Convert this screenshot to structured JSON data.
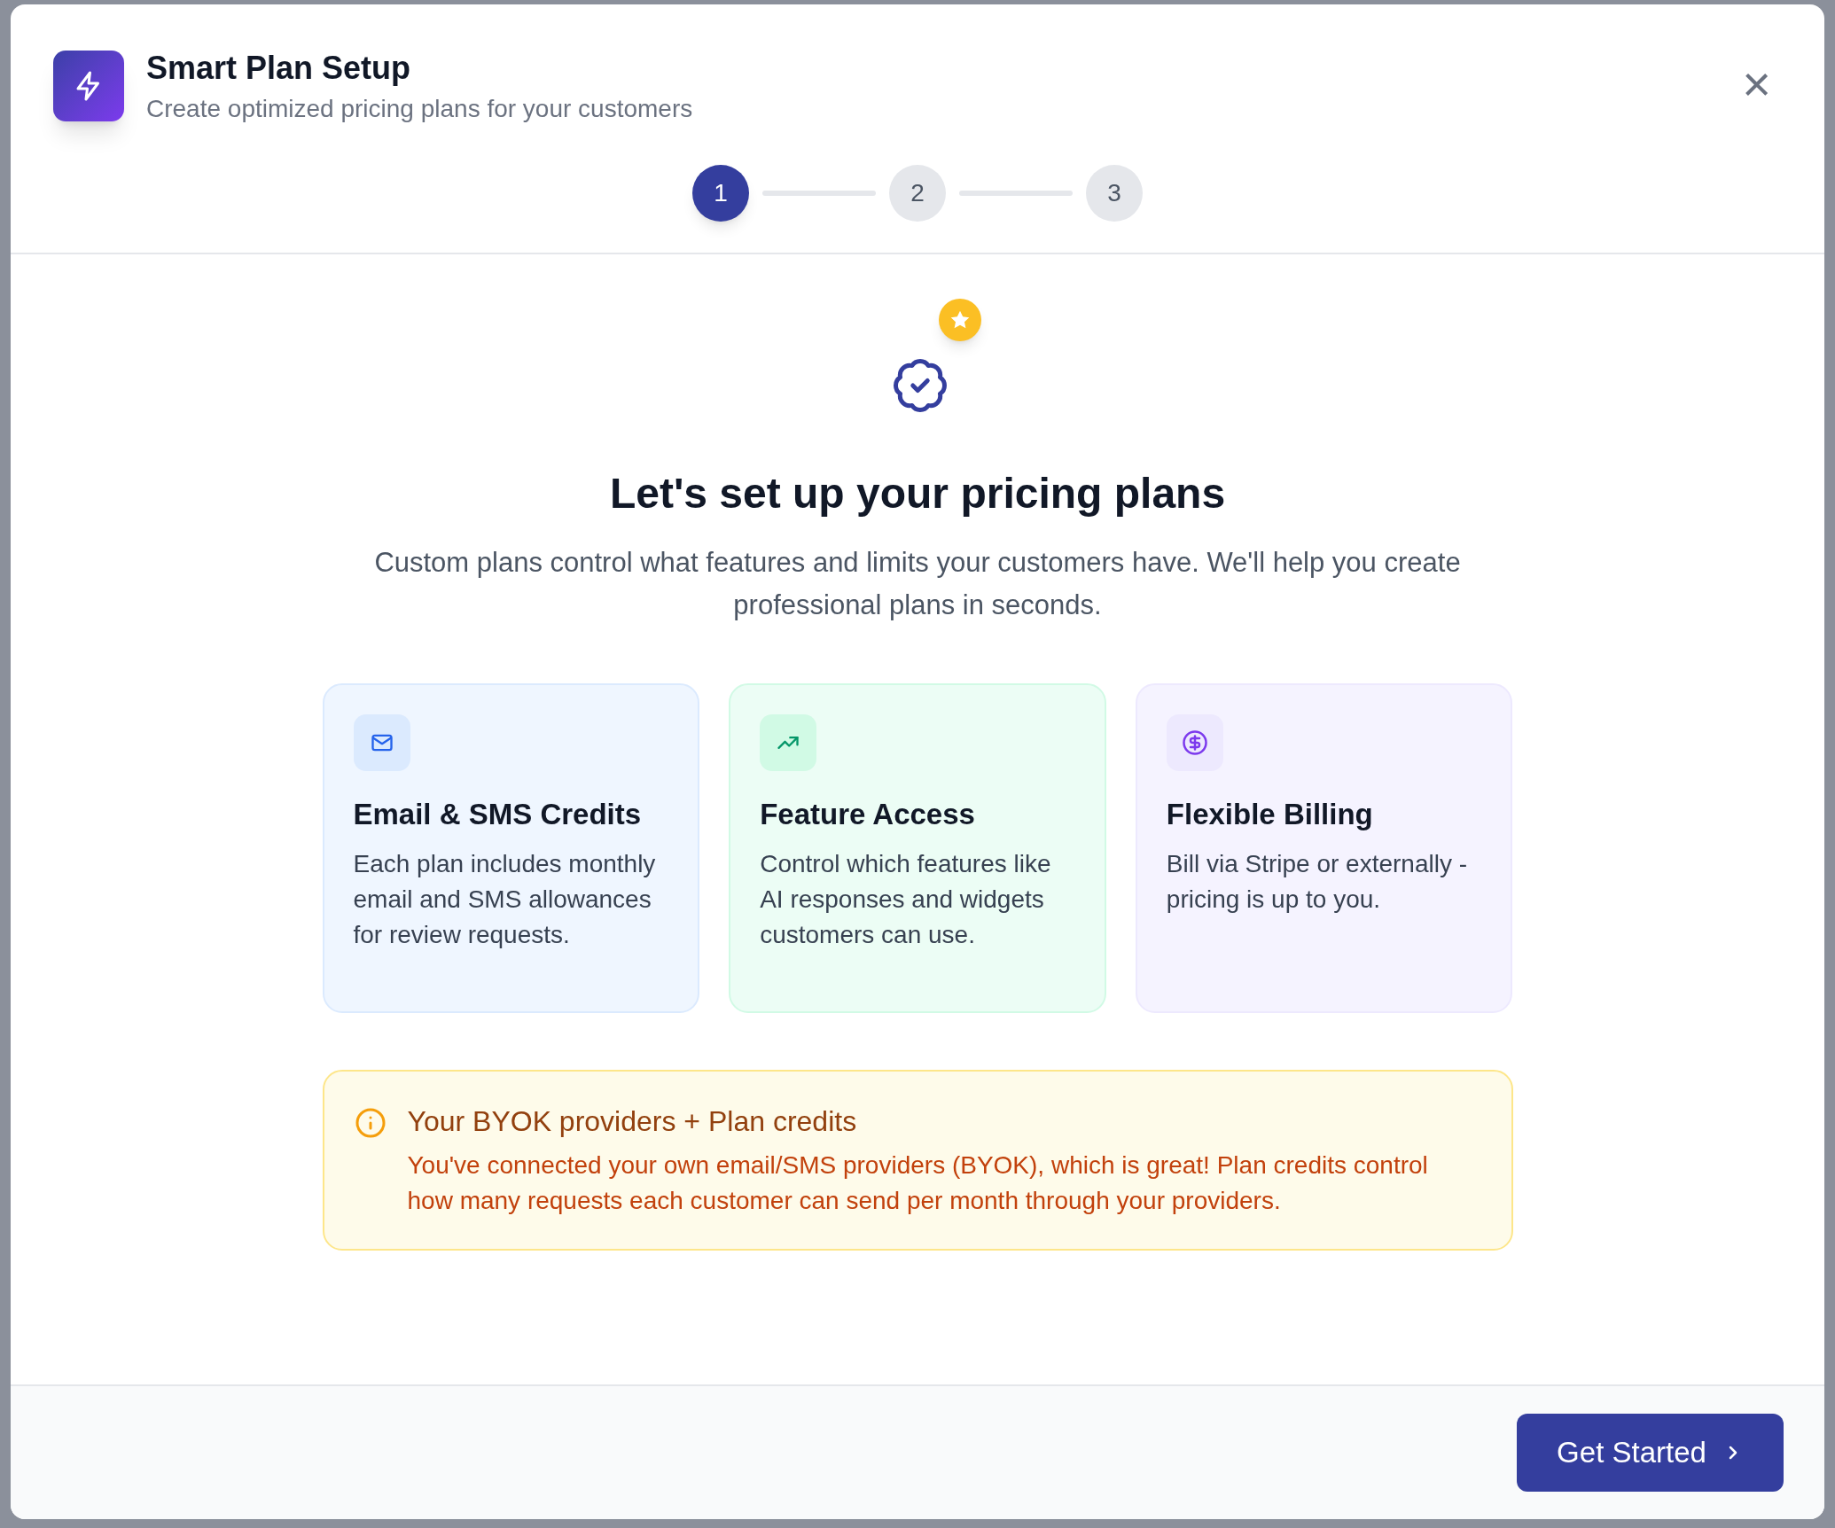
{
  "dialog": {
    "title": "Smart Plan Setup",
    "subtitle": "Create optimized pricing plans for your customers",
    "close": "×"
  },
  "steps": [
    {
      "label": "1",
      "selected": true
    },
    {
      "label": "2",
      "selected": false
    },
    {
      "label": "3",
      "selected": false
    }
  ],
  "intro": {
    "heading": "Let's set up your pricing plans",
    "text": "Custom plans control what features and limits your customers have. We'll help you create professional plans in seconds."
  },
  "features": [
    {
      "kind": "mail",
      "title": "Email & SMS Credits",
      "text": "Each plan includes monthly email and SMS allowances for review requests."
    },
    {
      "kind": "trend",
      "title": "Feature Access",
      "text": "Control which features like AI responses and widgets customers can use."
    },
    {
      "kind": "dollar",
      "title": "Flexible Billing",
      "text": "Bill via Stripe or externally - pricing is up to you."
    }
  ],
  "notice": {
    "title": "Your BYOK providers + Plan credits",
    "text": "You've connected your own email/SMS providers (BYOK), which is great! Plan credits control how many requests each customer can send per month through your providers."
  },
  "footer": {
    "button": "Get Started"
  }
}
